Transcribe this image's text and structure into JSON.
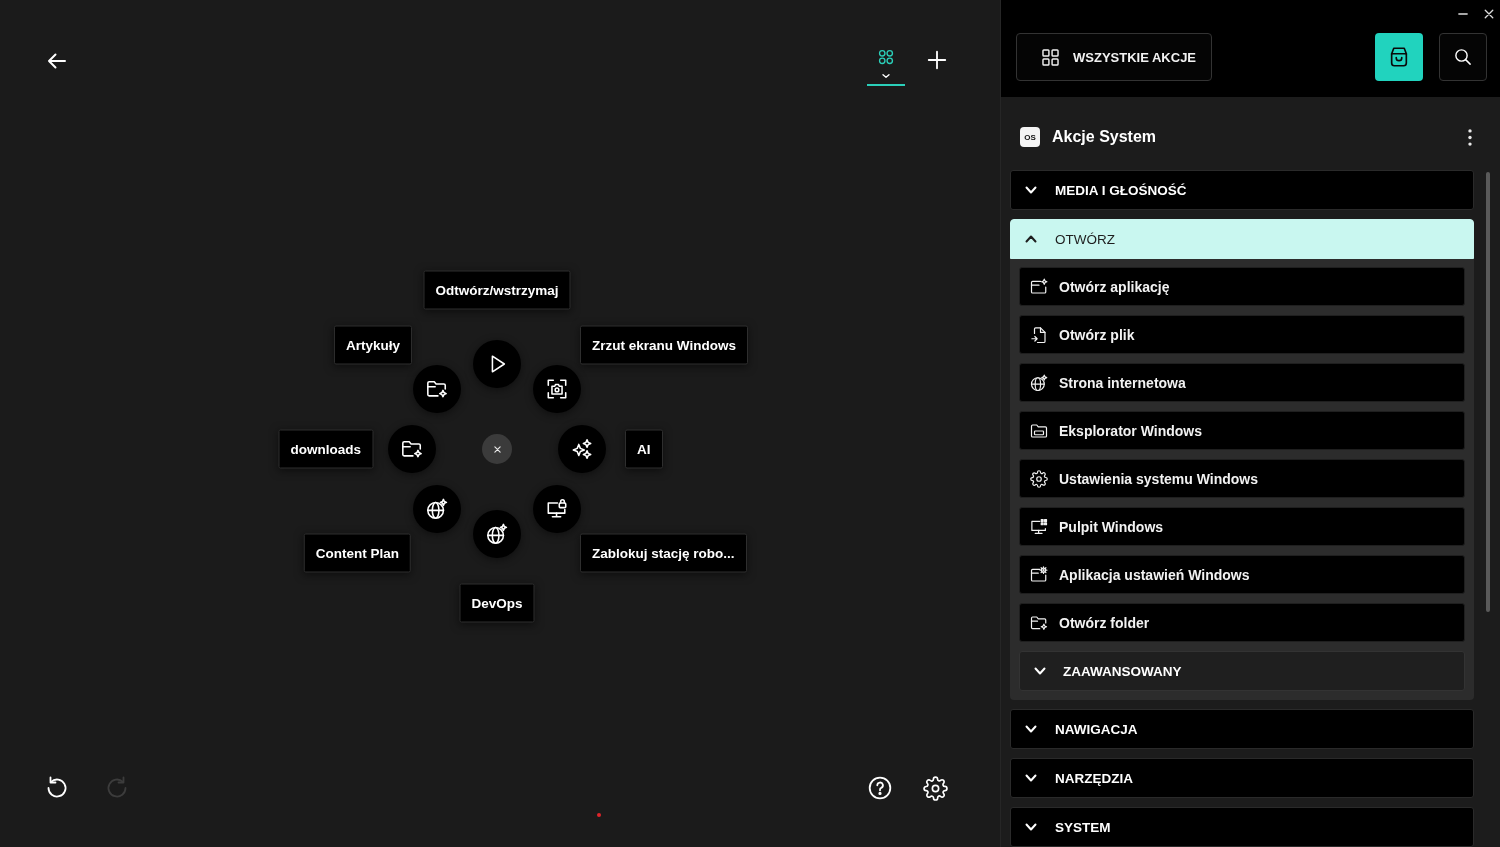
{
  "canvas": {
    "layout_tab": {
      "selected": true
    },
    "radial_menu": {
      "slots": [
        {
          "label": "Odtwórz/wstrzymaj"
        },
        {
          "label": "Artykuły"
        },
        {
          "label": "Zrzut ekranu Windows"
        },
        {
          "label": "downloads"
        },
        {
          "label": "AI"
        },
        {
          "label": "Content Plan"
        },
        {
          "label": "Zablokuj stację robo..."
        },
        {
          "label": "DevOps"
        }
      ]
    },
    "undo": {
      "disabled": false
    },
    "redo": {
      "disabled": true
    }
  },
  "panel": {
    "all_actions_button": "WSZYSTKIE AKCJE",
    "section": {
      "logo": "OS",
      "title": "Akcje System"
    },
    "categories": [
      {
        "label": "MEDIA I GŁOŚNOŚĆ",
        "expanded": false
      },
      {
        "label": "OTWÓRZ",
        "expanded": true,
        "actions": [
          {
            "label": "Otwórz aplikację"
          },
          {
            "label": "Otwórz plik"
          },
          {
            "label": "Strona internetowa"
          },
          {
            "label": "Eksplorator Windows"
          },
          {
            "label": "Ustawienia systemu Windows"
          },
          {
            "label": "Pulpit Windows"
          },
          {
            "label": "Aplikacja ustawień Windows"
          },
          {
            "label": "Otwórz folder"
          }
        ],
        "subgroups": [
          {
            "label": "ZAAWANSOWANY",
            "expanded": false
          }
        ]
      },
      {
        "label": "NAWIGACJA",
        "expanded": false
      },
      {
        "label": "NARZĘDZIA",
        "expanded": false
      },
      {
        "label": "SYSTEM",
        "expanded": false
      }
    ]
  }
}
